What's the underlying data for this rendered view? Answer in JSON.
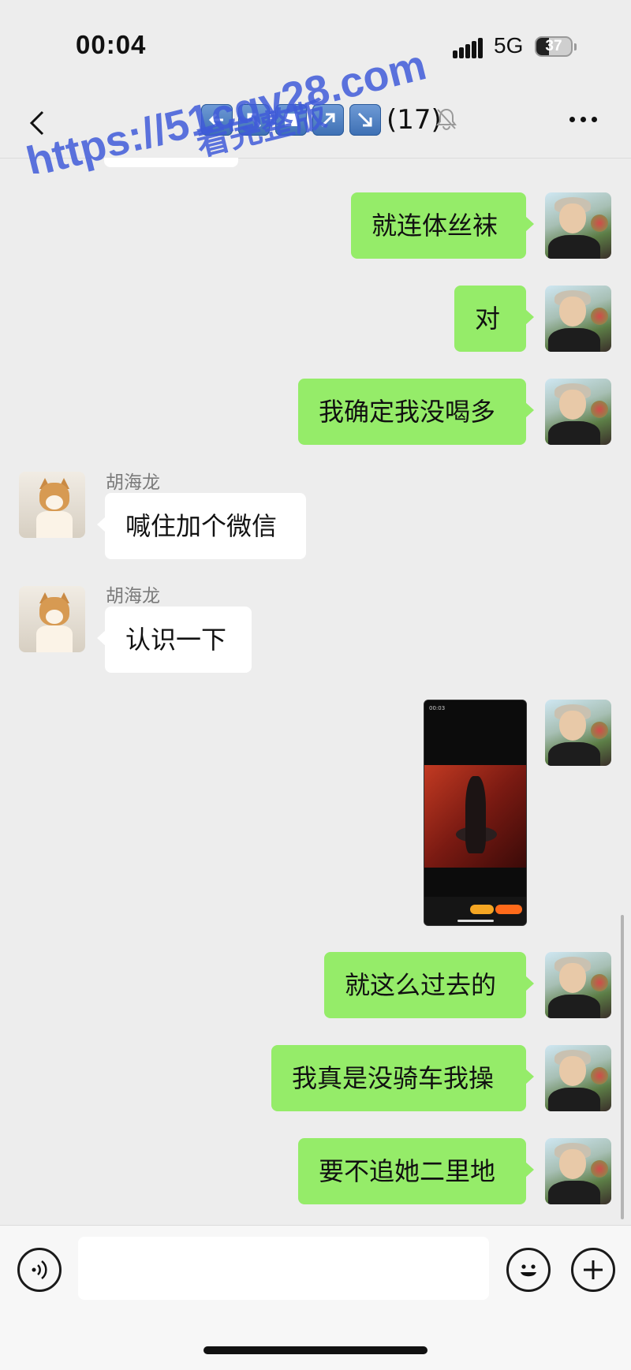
{
  "status_bar": {
    "time": "00:04",
    "network": "5G",
    "battery": "37",
    "battery_level": 0.37
  },
  "header": {
    "title_emoji_icons": [
      "left-arrow-icon",
      "up-left-arrow-icon",
      "stop-square-icon",
      "up-right-arrow-icon",
      "down-right-arrow-icon"
    ],
    "member_count": "(17)",
    "muted": true
  },
  "watermark": {
    "url": "https://51cgy28.com",
    "caption": "看完整版",
    "color": "#3f5bd8"
  },
  "messages": [
    {
      "side": "me",
      "text": "就连体丝袜"
    },
    {
      "side": "me",
      "text": "对"
    },
    {
      "side": "me",
      "text": "我确定我没喝多"
    },
    {
      "side": "them",
      "sender": "胡海龙",
      "text": "喊住加个微信"
    },
    {
      "side": "them",
      "sender": "胡海龙",
      "text": "认识一下"
    },
    {
      "side": "me",
      "type": "image",
      "image_time": "00:03"
    },
    {
      "side": "me",
      "text": "就这么过去的"
    },
    {
      "side": "me",
      "text": "我真是没骑车我操"
    },
    {
      "side": "me",
      "text": "要不追她二里地"
    }
  ],
  "colors": {
    "background": "#ededed",
    "my_bubble": "#95ec69",
    "their_bubble": "#ffffff"
  }
}
